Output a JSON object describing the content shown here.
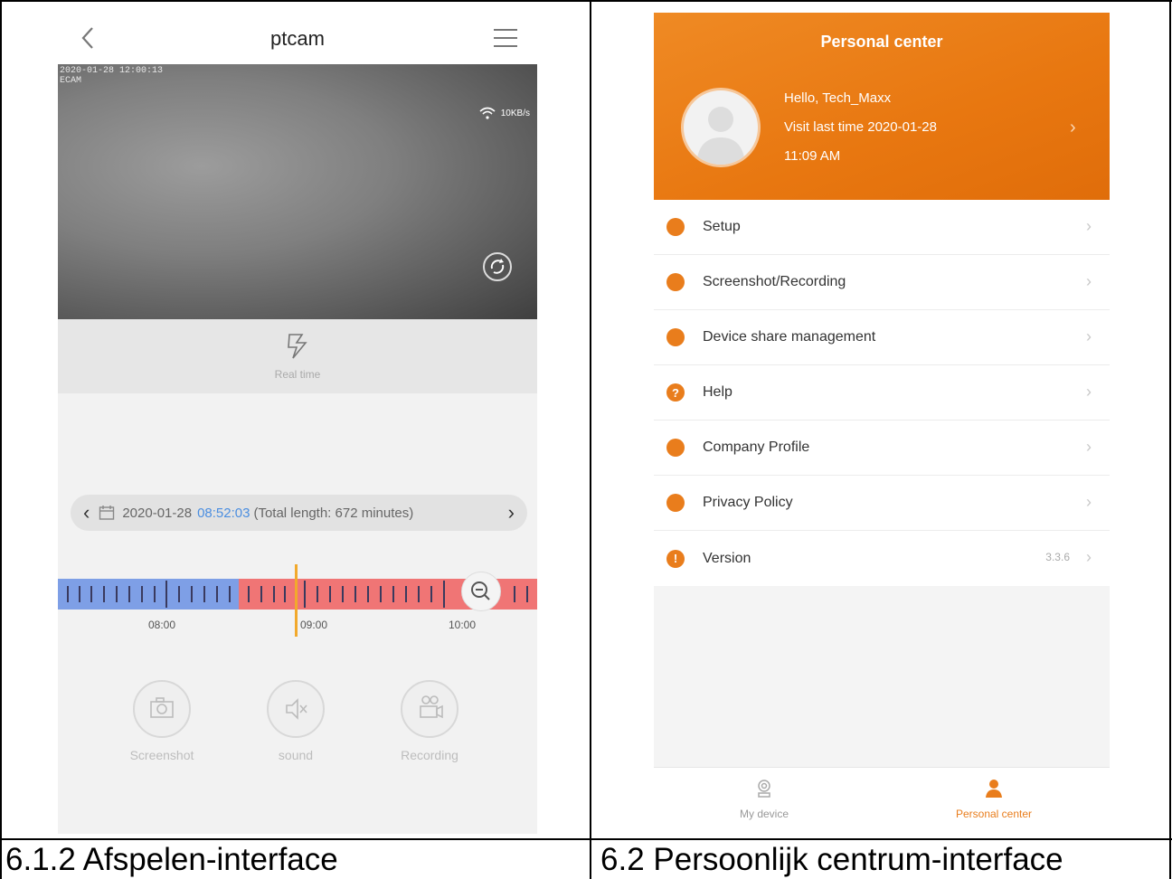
{
  "left_app": {
    "title": "ptcam",
    "video": {
      "timestamp_line1": "2020-01-28 12:00:13",
      "timestamp_line2": "ECAM",
      "speed": "10KB/s"
    },
    "realtime_label": "Real time",
    "date_bar": {
      "date": "2020-01-28",
      "time": "08:52:03",
      "total": "(Total length: 672 minutes)"
    },
    "timeline_labels": [
      "08:00",
      "09:00",
      "10:00"
    ],
    "controls": [
      {
        "label": "Screenshot"
      },
      {
        "label": "sound"
      },
      {
        "label": "Recording"
      }
    ]
  },
  "right_app": {
    "title": "Personal center",
    "greeting": "Hello, Tech_Maxx",
    "visit": "Visit last time 2020-01-28",
    "visit_time": "11:09 AM",
    "menu": [
      {
        "label": "Setup",
        "icon": "gear-icon"
      },
      {
        "label": "Screenshot/Recording",
        "icon": "camera-icon"
      },
      {
        "label": "Device share management",
        "icon": "share-icon"
      },
      {
        "label": "Help",
        "icon": "help-icon",
        "glyph": "?"
      },
      {
        "label": "Company Profile",
        "icon": "company-icon"
      },
      {
        "label": "Privacy Policy",
        "icon": "privacy-icon"
      },
      {
        "label": "Version",
        "icon": "info-icon",
        "glyph": "!",
        "value": "3.3.6"
      }
    ],
    "tabs": [
      {
        "label": "My device",
        "active": false
      },
      {
        "label": "Personal center",
        "active": true
      }
    ],
    "accent_color": "#e97d1c"
  },
  "captions": {
    "left": "6.1.2 Afspelen-interface",
    "right": "6.2 Persoonlijk centrum-interface"
  }
}
